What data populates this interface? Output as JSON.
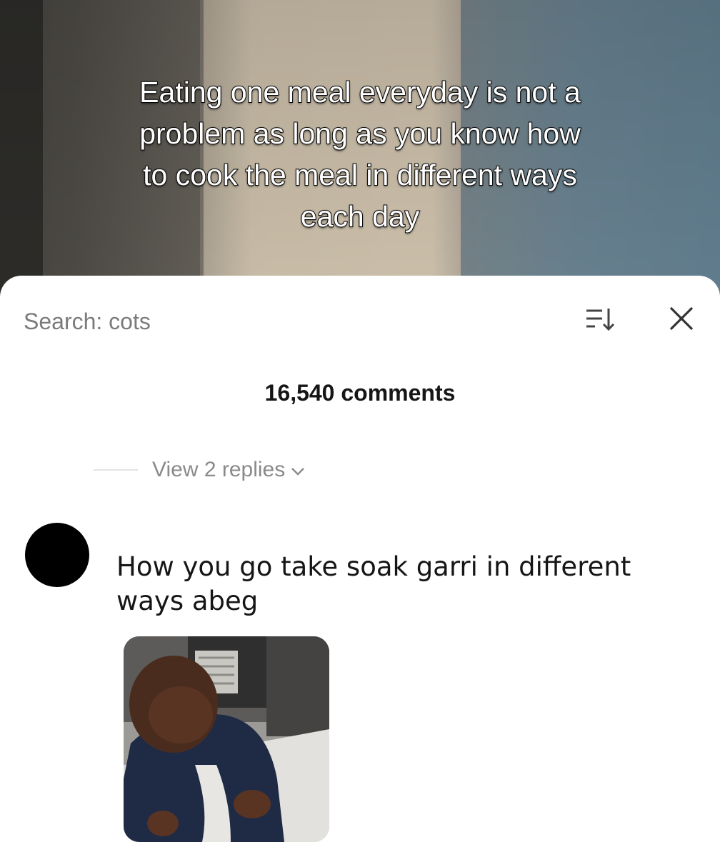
{
  "video": {
    "caption": "Eating one meal everyday is not a\nproblem as long as you know how\nto cook the meal in different ways\neach day"
  },
  "comments_panel": {
    "search_label": "Search: cots",
    "sort_icon": "sort-down-icon",
    "close_icon": "close-icon",
    "comment_count": "16,540 comments",
    "view_replies": "View 2 replies",
    "comment": {
      "avatar_color": "#000000",
      "text": "How you go take soak garri in different ways abeg",
      "attachment": "gif-sticker"
    }
  }
}
